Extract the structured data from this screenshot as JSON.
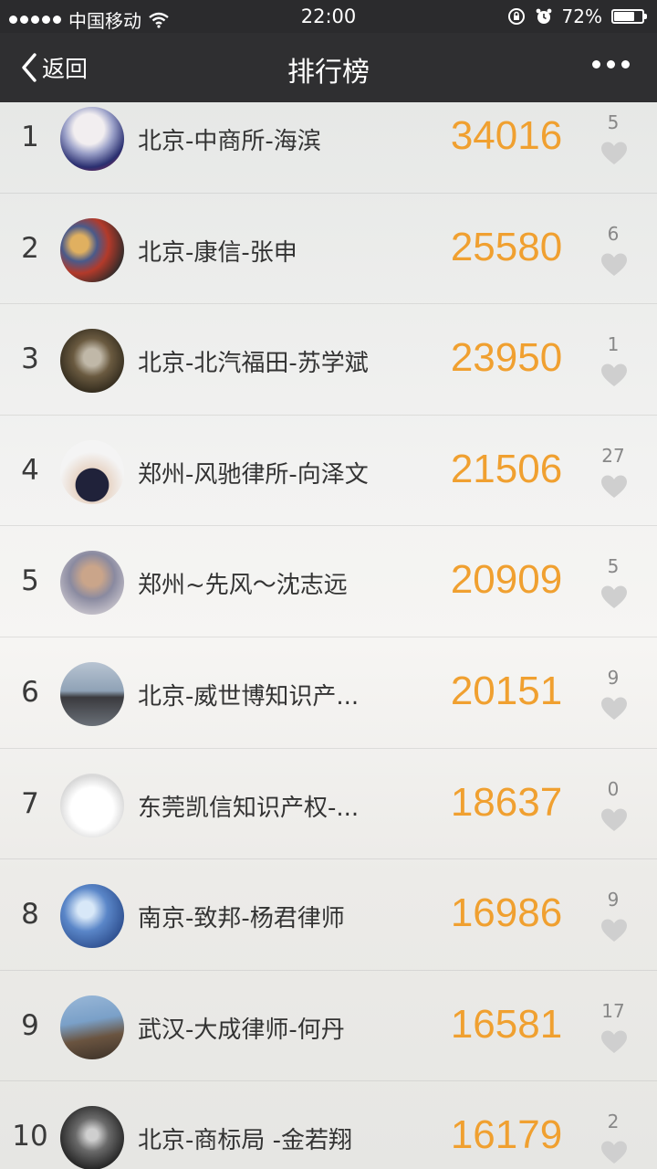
{
  "status": {
    "carrier": "中国移动",
    "time": "22:00",
    "battery": "72%",
    "battery_fraction": 0.72
  },
  "nav": {
    "back_label": "返回",
    "title": "排行榜",
    "more_icon": "more-icon"
  },
  "colors": {
    "score": "#f0a030",
    "nav_bg": "#2f2f31"
  },
  "rows": [
    {
      "rank": "1",
      "name": "北京-中商所-海滨",
      "score": "34016",
      "likes": "5"
    },
    {
      "rank": "2",
      "name": "北京-康信-张申",
      "score": "25580",
      "likes": "6"
    },
    {
      "rank": "3",
      "name": "北京-北汽福田-苏学斌",
      "score": "23950",
      "likes": "1"
    },
    {
      "rank": "4",
      "name": "郑州-风驰律所-向泽文",
      "score": "21506",
      "likes": "27"
    },
    {
      "rank": "5",
      "name": "郑州~先风～沈志远",
      "score": "20909",
      "likes": "5"
    },
    {
      "rank": "6",
      "name": "北京-威世博知识产...",
      "score": "20151",
      "likes": "9"
    },
    {
      "rank": "7",
      "name": "东莞凯信知识产权-...",
      "score": "18637",
      "likes": "0"
    },
    {
      "rank": "8",
      "name": "南京-致邦-杨君律师",
      "score": "16986",
      "likes": "9"
    },
    {
      "rank": "9",
      "name": "武汉-大成律师-何丹",
      "score": "16581",
      "likes": "17"
    },
    {
      "rank": "10",
      "name": "北京-商标局 -金若翔",
      "score": "16179",
      "likes": "2"
    }
  ]
}
